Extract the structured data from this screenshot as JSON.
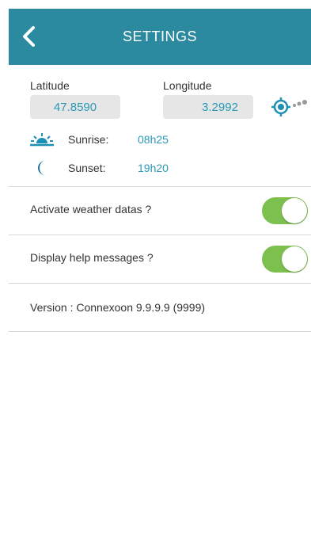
{
  "header": {
    "title": "SETTINGS"
  },
  "location": {
    "latitude_label": "Latitude",
    "latitude_value": "47.8590",
    "longitude_label": "Longitude",
    "longitude_value": "3.2992",
    "sunrise_label": "Sunrise:",
    "sunrise_value": "08h25",
    "sunset_label": "Sunset:",
    "sunset_value": "19h20"
  },
  "settings": [
    {
      "label": "Activate weather datas ?",
      "enabled": true
    },
    {
      "label": "Display help messages ?",
      "enabled": true
    }
  ],
  "version_text": "Version : Connexoon 9.9.9.9 (9999)",
  "colors": {
    "header": "#2b8aa0",
    "accent": "#2a9ab5",
    "toggle_on": "#7dc04f",
    "sun": "#1e8fb5",
    "moon": "#1e6fa5"
  },
  "icons": {
    "back": "chevron-left-icon",
    "locate": "crosshair-locate-icon",
    "sun": "sunrise-icon",
    "moon": "moon-icon"
  }
}
